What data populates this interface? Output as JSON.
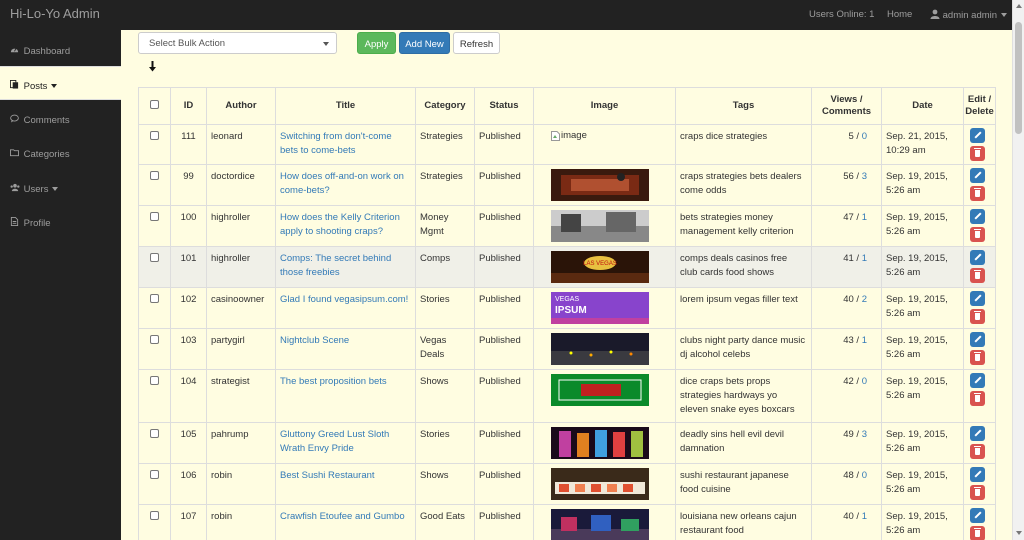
{
  "app": {
    "brand": "Hi-Lo-Yo Admin"
  },
  "topnav": {
    "users_online": "Users Online: 1",
    "home": "Home",
    "user": "admin admin"
  },
  "sidebar": {
    "items": [
      {
        "label": "Dashboard",
        "icon": "dashboard-icon"
      },
      {
        "label": "Posts",
        "icon": "posts-icon",
        "active": true
      },
      {
        "label": "Comments",
        "icon": "comments-icon"
      },
      {
        "label": "Categories",
        "icon": "folder-icon"
      },
      {
        "label": "Users",
        "icon": "users-icon"
      },
      {
        "label": "Profile",
        "icon": "profile-icon"
      }
    ]
  },
  "toolbar": {
    "bulk_select": "Select Bulk Action",
    "apply": "Apply",
    "add_new": "Add New",
    "refresh": "Refresh"
  },
  "colors": {
    "accent": "#337ab7",
    "success": "#5cb85c",
    "danger": "#d9534f",
    "bg": "#fffde1",
    "dark": "#222222"
  },
  "table": {
    "headers": [
      "",
      "ID",
      "Author",
      "Title",
      "Category",
      "Status",
      "Image",
      "Tags",
      "Views / Comments",
      "Date",
      "Edit / Delete"
    ],
    "image_alt": "image",
    "rows": [
      {
        "id": "111",
        "author": "leonard",
        "title": "Switching from don't-come bets to come-bets",
        "category": "Strategies",
        "status": "Published",
        "image": "broken",
        "tags": "craps dice strategies",
        "views": "5",
        "comments": "0",
        "date": "Sep. 21, 2015, 10:29 am"
      },
      {
        "id": "99",
        "author": "doctordice",
        "title": "How does off-and-on work on come-bets?",
        "category": "Strategies",
        "status": "Published",
        "image": "craps-table",
        "tags": "craps strategies bets dealers come odds",
        "views": "56",
        "comments": "3",
        "date": "Sep. 19, 2015, 5:26 am"
      },
      {
        "id": "100",
        "author": "highroller",
        "title": "How does the Kelly Criterion apply to shooting craps?",
        "category": "Money Mgmt",
        "status": "Published",
        "image": "bw-casino",
        "tags": "bets strategies money management kelly criterion",
        "views": "47",
        "comments": "1",
        "date": "Sep. 19, 2015, 5:26 am"
      },
      {
        "id": "101",
        "author": "highroller",
        "title": "Comps: The secret behind those freebies",
        "category": "Comps",
        "status": "Published",
        "image": "vegas-sign",
        "tags": "comps deals casinos free club cards food shows",
        "views": "41",
        "comments": "1",
        "date": "Sep. 19, 2015, 5:26 am",
        "highlight": true
      },
      {
        "id": "102",
        "author": "casinoowner",
        "title": "Glad I found vegasipsum.com!",
        "category": "Stories",
        "status": "Published",
        "image": "vegas-ipsum",
        "tags": "lorem ipsum vegas filler text",
        "views": "40",
        "comments": "2",
        "date": "Sep. 19, 2015, 5:26 am"
      },
      {
        "id": "103",
        "author": "partygirl",
        "title": "Nightclub Scene",
        "category": "Vegas Deals",
        "status": "Published",
        "image": "night-city",
        "tags": "clubs night party dance music dj alcohol celebs",
        "views": "43",
        "comments": "1",
        "date": "Sep. 19, 2015, 5:26 am"
      },
      {
        "id": "104",
        "author": "strategist",
        "title": "The best proposition bets",
        "category": "Shows",
        "status": "Published",
        "image": "craps-layout",
        "tags": "dice craps bets props strategies hardways yo eleven snake eyes boxcars",
        "views": "42",
        "comments": "0",
        "date": "Sep. 19, 2015, 5:26 am"
      },
      {
        "id": "105",
        "author": "pahrump",
        "title": "Gluttony Greed Lust Sloth Wrath Envy Pride",
        "category": "Stories",
        "status": "Published",
        "image": "sins",
        "tags": "deadly sins hell evil devil damnation",
        "views": "49",
        "comments": "3",
        "date": "Sep. 19, 2015, 5:26 am"
      },
      {
        "id": "106",
        "author": "robin",
        "title": "Best Sushi Restaurant",
        "category": "Shows",
        "status": "Published",
        "image": "sushi",
        "tags": "sushi restaurant japanese food cuisine",
        "views": "48",
        "comments": "0",
        "date": "Sep. 19, 2015, 5:26 am"
      },
      {
        "id": "107",
        "author": "robin",
        "title": "Crawfish Etoufee and Gumbo",
        "category": "Good Eats",
        "status": "Published",
        "image": "neworleans",
        "tags": "louisiana new orleans cajun restaurant food",
        "views": "40",
        "comments": "1",
        "date": "Sep. 19, 2015, 5:26 am"
      }
    ]
  }
}
